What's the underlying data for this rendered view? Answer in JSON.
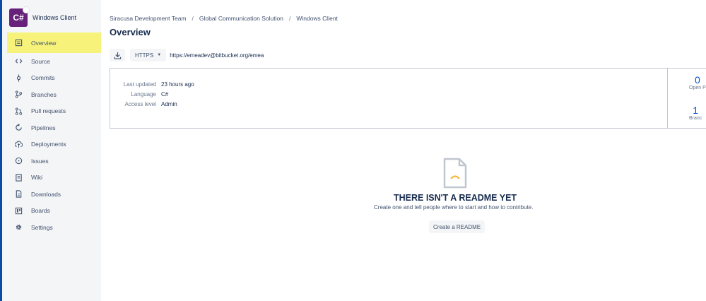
{
  "repo": {
    "name": "Windows Client",
    "avatar_text": "C#",
    "avatar_color": "#68217a"
  },
  "sidebar": {
    "items": [
      {
        "label": "Overview",
        "icon": "overview-icon"
      },
      {
        "label": "Source",
        "icon": "source-icon"
      },
      {
        "label": "Commits",
        "icon": "commits-icon"
      },
      {
        "label": "Branches",
        "icon": "branches-icon"
      },
      {
        "label": "Pull requests",
        "icon": "pull-requests-icon"
      },
      {
        "label": "Pipelines",
        "icon": "pipelines-icon"
      },
      {
        "label": "Deployments",
        "icon": "deployments-icon"
      },
      {
        "label": "Issues",
        "icon": "issues-icon"
      },
      {
        "label": "Wiki",
        "icon": "wiki-icon"
      },
      {
        "label": "Downloads",
        "icon": "downloads-icon"
      },
      {
        "label": "Boards",
        "icon": "boards-icon"
      },
      {
        "label": "Settings",
        "icon": "settings-icon"
      }
    ],
    "active_highlight": "#f7f37a"
  },
  "breadcrumb": [
    "Siracusa Development Team",
    "Global Communication Solution",
    "Windows Client"
  ],
  "page_title": "Overview",
  "clone": {
    "protocol": "HTTPS",
    "url": "https://emeadev@bitbucket.org/emea"
  },
  "info": {
    "rows": [
      {
        "label": "Last updated",
        "value": "23 hours ago"
      },
      {
        "label": "Language",
        "value": "C#"
      },
      {
        "label": "Access level",
        "value": "Admin"
      }
    ]
  },
  "stats": [
    {
      "value": "0",
      "label": "Open P"
    },
    {
      "value": "1",
      "label": "Branc"
    }
  ],
  "readme": {
    "title": "THERE ISN'T A README YET",
    "subtitle": "Create one and tell people where to start and how to contribute.",
    "button": "Create a README"
  },
  "colors": {
    "accent_blue": "#0052cc",
    "edge_blue": "#0a4ba8"
  }
}
